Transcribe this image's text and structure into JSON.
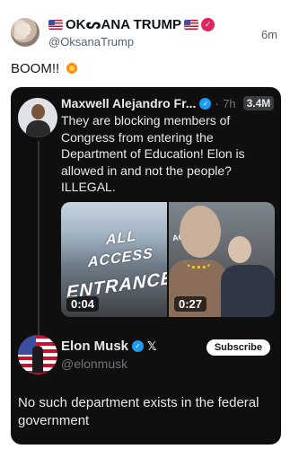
{
  "author": {
    "display_name": "OKᔕANA TRUMP",
    "handle": "@OksanaTrump",
    "time": "6m",
    "verified_symbol": "✓",
    "flag_icon": "us-flag-icon"
  },
  "post": {
    "text": "BOOM!!",
    "emoji_icon": "collision-icon"
  },
  "quoted_post": {
    "author_name": "Maxwell Alejandro Fr...",
    "verified_symbol": "✓",
    "dot": "·",
    "time": "7h",
    "views": "3.4M",
    "text": "They are blocking members of Congress from entering the Department of Education! Elon is allowed in and not the people? ILLEGAL.",
    "media": [
      {
        "duration": "0:04",
        "sign_lines": [
          "ALL",
          "ACCESS",
          "ENTRANCE"
        ]
      },
      {
        "duration": "0:27",
        "sign_text": "ACE"
      }
    ]
  },
  "reply": {
    "author_name": "Elon Musk",
    "verified_symbol": "✓",
    "affiliate_label": "𝕏",
    "handle": "@elonmusk",
    "subscribe_label": "Subscribe",
    "text": "No such department exists in the federal government"
  },
  "colors": {
    "accent_blue": "#1d9bf0",
    "verified_red": "#e0245e",
    "dark_card": "#0f0f10"
  }
}
